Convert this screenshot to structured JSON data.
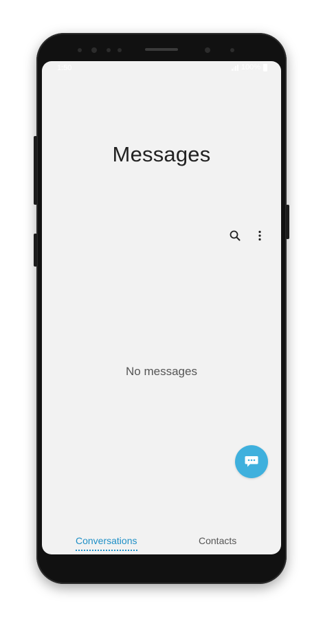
{
  "status_bar": {
    "time": "1:50",
    "battery": "100%"
  },
  "header": {
    "title": "Messages"
  },
  "actions": {
    "search_icon": "search-icon",
    "more_icon": "more-vert-icon"
  },
  "main": {
    "empty_text": "No messages"
  },
  "fab": {
    "icon": "compose-chat-icon",
    "color": "#3fb0dd"
  },
  "tabs": [
    {
      "label": "Conversations",
      "active": true,
      "color": "#1e8fc6"
    },
    {
      "label": "Contacts",
      "active": false
    }
  ],
  "nav": {
    "recent_icon": "recent-apps-icon",
    "home_icon": "home-icon",
    "back_icon": "back-icon"
  }
}
